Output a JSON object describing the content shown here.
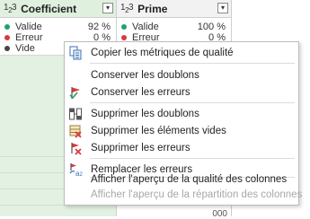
{
  "columns": [
    {
      "type_icon": "1²3",
      "title": "Coefficient",
      "dropdown_icon": "chevron-down-icon",
      "quality": [
        {
          "label": "Valide",
          "value": "92 %",
          "color": "#1aa56b"
        },
        {
          "label": "Erreur",
          "value": "0 %",
          "color": "#d9393e"
        },
        {
          "label": "Vide",
          "value": "",
          "color": "#444444"
        }
      ]
    },
    {
      "type_icon": "1²3",
      "title": "Prime",
      "dropdown_icon": "chevron-down-icon",
      "quality": [
        {
          "label": "Valide",
          "value": "100 %",
          "color": "#1aa56b"
        },
        {
          "label": "Erreur",
          "value": "0 %",
          "color": "#d9393e"
        }
      ],
      "cells": [
        "null",
        "000"
      ]
    }
  ],
  "menu": {
    "items": [
      {
        "label": "Copier les métriques de qualité",
        "icon": "copy-icon",
        "enabled": true
      },
      {
        "label": "Conserver les doublons",
        "icon": "",
        "enabled": true
      },
      {
        "label": "Conserver les erreurs",
        "icon": "keep-errors-flag-icon",
        "enabled": true
      },
      {
        "label": "Supprimer les doublons",
        "icon": "remove-duplicates-icon",
        "enabled": true
      },
      {
        "label": "Supprimer les éléments vides",
        "icon": "remove-empty-icon",
        "enabled": true
      },
      {
        "label": "Supprimer les erreurs",
        "icon": "remove-errors-icon",
        "enabled": true
      },
      {
        "label": "Remplacer les erreurs",
        "icon": "replace-errors-icon",
        "enabled": true
      },
      {
        "label": "Afficher l'aperçu de la qualité des colonnes",
        "icon": "",
        "enabled": true
      },
      {
        "label": "Afficher l'aperçu de la répartition des colonnes",
        "icon": "",
        "enabled": false
      }
    ]
  },
  "colors": {
    "selected_column": "#e2f1e1",
    "valid": "#1aa56b",
    "error": "#d9393e",
    "empty": "#444444"
  }
}
